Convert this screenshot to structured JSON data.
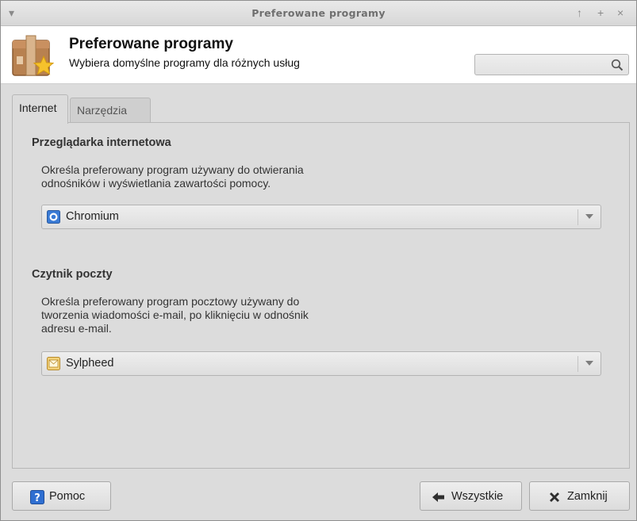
{
  "window": {
    "title": "Preferowane programy",
    "controls": [
      "▾",
      "↑",
      "+",
      "×"
    ]
  },
  "header": {
    "title": "Preferowane programy",
    "subtitle": "Wybiera domyślne programy dla różnych usług",
    "search": {
      "value": "",
      "placeholder": ""
    }
  },
  "tabs": [
    {
      "label": "Internet",
      "active": true
    },
    {
      "label": "Narzędzia",
      "active": false
    }
  ],
  "sections": [
    {
      "title": "Przeglądarka internetowa",
      "description": [
        "Określa preferowany program używany do otwierania",
        "odnośników i wyświetlania zawartości pomocy."
      ],
      "selected": "Chromium",
      "icon": "chromium-icon"
    },
    {
      "title": "Czytnik poczty",
      "description": [
        "Określa preferowany program pocztowy używany do",
        "tworzenia wiadomości e-mail, po kliknięciu w odnośnik",
        "adresu e-mail."
      ],
      "selected": "Sylpheed",
      "icon": "sylpheed-icon"
    }
  ],
  "buttons": {
    "help": "Pomoc",
    "all": "Wszystkie",
    "close": "Zamknij"
  },
  "colors": {
    "window_bg": "#dcdcdc",
    "header_bg": "#ffffff",
    "help_icon_bg": "#2f6fd1",
    "chromium_icon": "#3a7bd5"
  }
}
